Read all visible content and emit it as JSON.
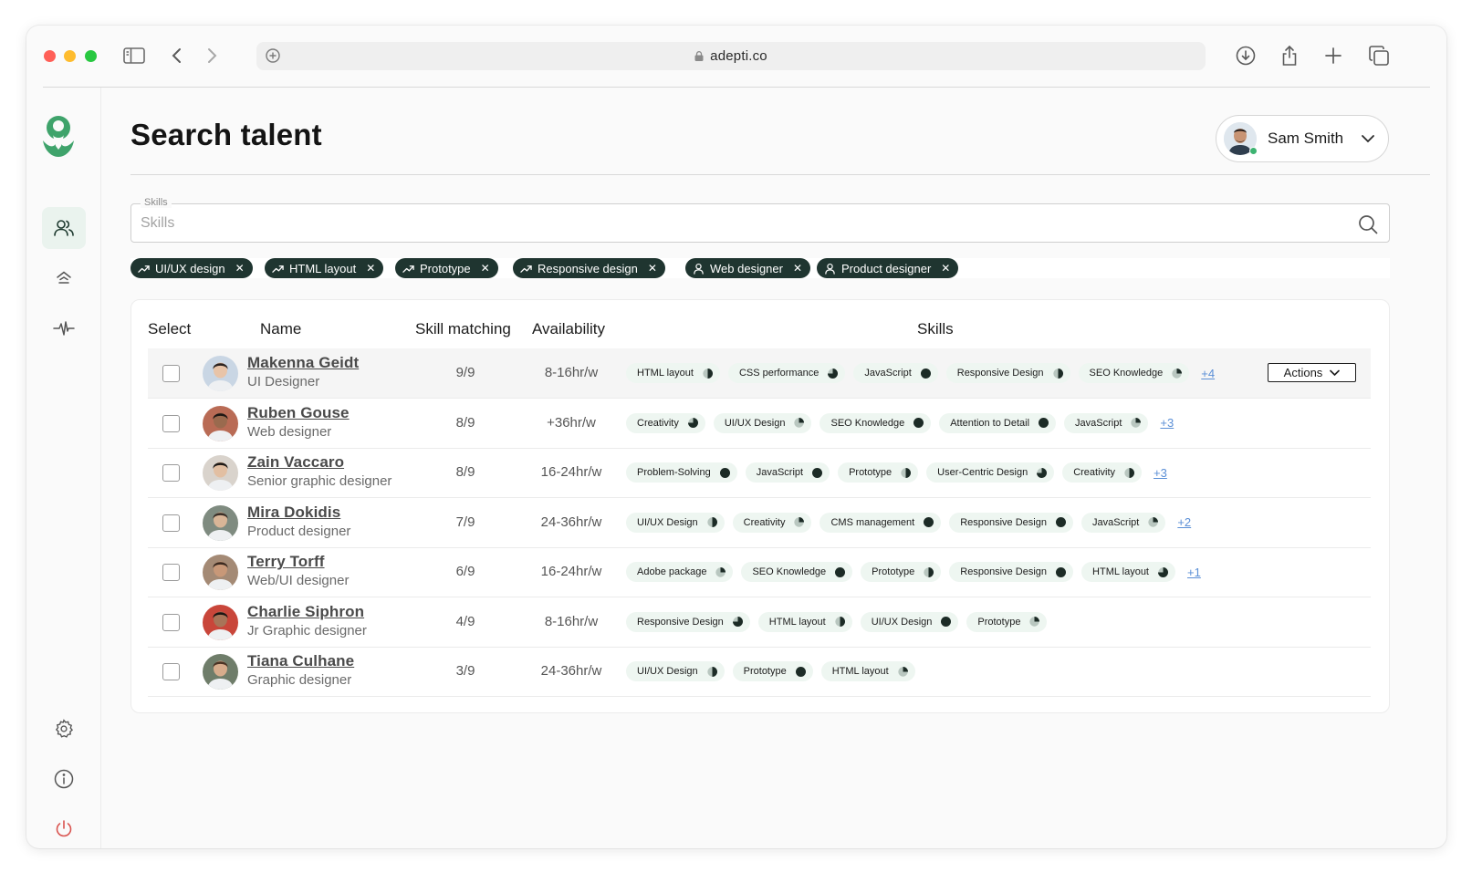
{
  "browser": {
    "url": "adepti.co"
  },
  "page": {
    "title": "Search talent"
  },
  "user": {
    "name": "Sam Smith"
  },
  "search": {
    "legend": "Skills",
    "placeholder": "Skills"
  },
  "chips": [
    {
      "label": "UI/UX design",
      "icon": "trend-icon"
    },
    {
      "label": "HTML layout",
      "icon": "trend-icon"
    },
    {
      "label": "Prototype",
      "icon": "trend-icon"
    },
    {
      "label": "Responsive design",
      "icon": "trend-icon"
    },
    {
      "label": "Web designer",
      "icon": "person-icon"
    },
    {
      "label": "Product designer",
      "icon": "person-icon"
    }
  ],
  "table": {
    "headers": {
      "select": "Select",
      "name": "Name",
      "skill_matching": "Skill matching",
      "availability": "Availability",
      "skills": "Skills"
    },
    "actions_label": "Actions",
    "rows": [
      {
        "name": "Makenna Geidt",
        "role": "UI Designer",
        "match": "9/9",
        "availability": "8-16hr/w",
        "avatar_bg": "#c9d6e4",
        "skin": "#e8c4a8",
        "hair": "#2a2220",
        "skills": [
          {
            "label": "HTML layout",
            "level": 0.5
          },
          {
            "label": "CSS performance",
            "level": 0.75
          },
          {
            "label": "JavaScript",
            "level": 1
          },
          {
            "label": "Responsive Design",
            "level": 0.5
          },
          {
            "label": "SEO Knowledge",
            "level": 0.25
          }
        ],
        "more": "+4"
      },
      {
        "name": "Ruben Gouse",
        "role": "Web designer",
        "match": "8/9",
        "availability": "+36hr/w",
        "avatar_bg": "#b96b55",
        "skin": "#9a6a4e",
        "hair": "#1e1714",
        "skills": [
          {
            "label": "Creativity",
            "level": 0.75
          },
          {
            "label": "UI/UX Design",
            "level": 0.25
          },
          {
            "label": "SEO Knowledge",
            "level": 1
          },
          {
            "label": "Attention to Detail",
            "level": 1
          },
          {
            "label": "JavaScript",
            "level": 0.25
          }
        ],
        "more": "+3"
      },
      {
        "name": "Zain Vaccaro",
        "role": "Senior graphic designer",
        "match": "8/9",
        "availability": "16-24hr/w",
        "avatar_bg": "#d9d3cc",
        "skin": "#e2bfa2",
        "hair": "#1d1916",
        "skills": [
          {
            "label": "Problem-Solving",
            "level": 1
          },
          {
            "label": "JavaScript",
            "level": 1
          },
          {
            "label": "Prototype",
            "level": 0.5
          },
          {
            "label": "User-Centric Design",
            "level": 0.75
          },
          {
            "label": "Creativity",
            "level": 0.5
          }
        ],
        "more": "+3"
      },
      {
        "name": "Mira Dokidis",
        "role": "Product designer",
        "match": "7/9",
        "availability": "24-36hr/w",
        "avatar_bg": "#7f8b80",
        "skin": "#d9b597",
        "hair": "#3a2e27",
        "skills": [
          {
            "label": "UI/UX Design",
            "level": 0.5
          },
          {
            "label": "Creativity",
            "level": 0.25
          },
          {
            "label": "CMS management",
            "level": 1
          },
          {
            "label": "Responsive Design",
            "level": 1
          },
          {
            "label": "JavaScript",
            "level": 0.25
          }
        ],
        "more": "+2"
      },
      {
        "name": "Terry Torff",
        "role": "Web/UI designer",
        "match": "6/9",
        "availability": "16-24hr/w",
        "avatar_bg": "#a48a75",
        "skin": "#c89878",
        "hair": "#3b2a20",
        "skills": [
          {
            "label": "Adobe package",
            "level": 0.25
          },
          {
            "label": "SEO Knowledge",
            "level": 1
          },
          {
            "label": "Prototype",
            "level": 0.5
          },
          {
            "label": "Responsive Design",
            "level": 1
          },
          {
            "label": "HTML layout",
            "level": 0.75
          }
        ],
        "more": "+1"
      },
      {
        "name": "Charlie Siphron",
        "role": "Jr Graphic designer",
        "match": "4/9",
        "availability": "8-16hr/w",
        "avatar_bg": "#c9463a",
        "skin": "#a87458",
        "hair": "#1b1512",
        "skills": [
          {
            "label": "Responsive Design",
            "level": 0.75
          },
          {
            "label": "HTML layout",
            "level": 0.5
          },
          {
            "label": "UI/UX Design",
            "level": 1
          },
          {
            "label": "Prototype",
            "level": 0.25
          }
        ],
        "more": ""
      },
      {
        "name": "Tiana Culhane",
        "role": "Graphic designer",
        "match": "3/9",
        "availability": "24-36hr/w",
        "avatar_bg": "#6f7d6a",
        "skin": "#d7ac8c",
        "hair": "#4a3324",
        "skills": [
          {
            "label": "UI/UX Design",
            "level": 0.5
          },
          {
            "label": "Prototype",
            "level": 1
          },
          {
            "label": "HTML layout",
            "level": 0.25
          }
        ],
        "more": ""
      }
    ]
  },
  "colors": {
    "chip_bg": "#1f3530",
    "skill_bg": "#eef6f1",
    "pie_fill": "#1c2b26",
    "accent_green": "#3fa36b",
    "power_red": "#d9534f",
    "link_blue": "#5b8fd6"
  }
}
